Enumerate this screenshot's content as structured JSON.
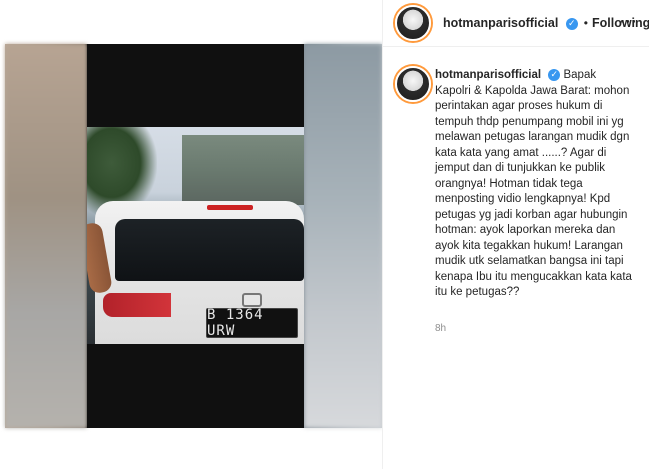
{
  "post": {
    "username": "hotmanparisofficial",
    "separator": "•",
    "follow_status": "Following",
    "caption": "Bapak Kapolri & Kapolda Jawa Barat: mohon perintakan agar proses hukum di tempuh thdp penumpang mobil ini yg melawan petugas larangan mudik dgn kata kata yang amat ......? Agar di jemput dan di tunjukkan ke publik orangnya! Hotman tidak tega menposting vidio lengkapnya! Kpd petugas yg jadi korban agar hubungin hotman: ayok laporkan mereka dan ayok kita tegakkan hukum! Larangan mudik utk selamatkan bangsa ini tapi kenapa Ibu itu mengucakkan kata kata itu ke petugas??",
    "time_ago": "8h"
  },
  "media": {
    "license_plate": "B 1364 URW"
  },
  "icons": {
    "verified": "verified-badge-icon",
    "more": "more-options-icon"
  },
  "colors": {
    "accent_blue": "#3897f0",
    "text": "#262626",
    "muted": "#8e8e8e",
    "story_ring": "#ff9a3c"
  }
}
